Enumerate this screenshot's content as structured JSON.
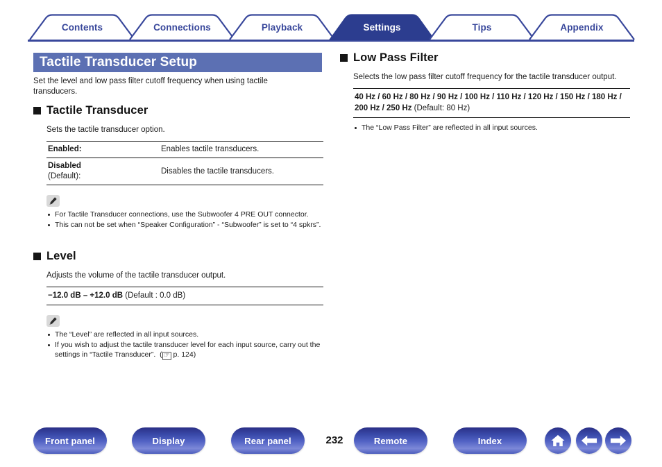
{
  "tabs": [
    {
      "label": "Contents",
      "active": false
    },
    {
      "label": "Connections",
      "active": false
    },
    {
      "label": "Playback",
      "active": false
    },
    {
      "label": "Settings",
      "active": true
    },
    {
      "label": "Tips",
      "active": false
    },
    {
      "label": "Appendix",
      "active": false
    }
  ],
  "page": {
    "title": "Tactile Transducer Setup",
    "intro": "Set the level and low pass filter cutoff frequency when using tactile transducers.",
    "number": "232",
    "title_bar_color": "#5c70b3",
    "accent_color": "#38479b"
  },
  "sections": {
    "tactile_transducer": {
      "heading": "Tactile Transducer",
      "description": "Sets the tactile transducer option.",
      "options": [
        {
          "key": "Enabled:",
          "key_bold": "Enabled:",
          "key_suffix": "",
          "value": "Enables tactile transducers."
        },
        {
          "key": "Disabled",
          "key_suffix": "(Default):",
          "value": "Disables the tactile transducers."
        }
      ],
      "note_icon": "pencil-icon",
      "notes": [
        "For Tactile Transducer connections, use the Subwoofer 4 PRE OUT connector.",
        "This can not be set when “Speaker Configuration” - “Subwoofer” is set to “4 spkrs”."
      ]
    },
    "level": {
      "heading": "Level",
      "description": "Adjusts the volume of the tactile transducer output.",
      "range_bold": "−12.0 dB – +12.0 dB",
      "range_default": " (Default : 0.0 dB)",
      "note_icon": "pencil-icon",
      "notes": [
        "The “Level” are reflected in all input sources.",
        "If you wish to adjust the tactile transducer level for each input source, carry out the settings in “Tactile Transducer”."
      ],
      "link_icon": "pointing-hand-icon",
      "link_text": "p. 124"
    },
    "low_pass_filter": {
      "heading": "Low Pass Filter",
      "description": "Selects the low pass filter cutoff frequency for the tactile transducer output.",
      "values_bold": "40 Hz / 60 Hz / 80 Hz / 90 Hz / 100 Hz / 110 Hz / 120 Hz / 150 Hz / 180 Hz / 200 Hz / 250 Hz",
      "values_default": " (Default: 80 Hz)",
      "notes": [
        "The “Low Pass Filter” are reflected in all input sources."
      ]
    }
  },
  "footer": {
    "buttons": [
      {
        "label": "Front panel"
      },
      {
        "label": "Display"
      },
      {
        "label": "Rear panel"
      },
      {
        "label": "Remote"
      },
      {
        "label": "Index"
      }
    ],
    "icon_buttons": [
      {
        "name": "home-icon"
      },
      {
        "name": "arrow-left-icon"
      },
      {
        "name": "arrow-right-icon"
      }
    ]
  }
}
